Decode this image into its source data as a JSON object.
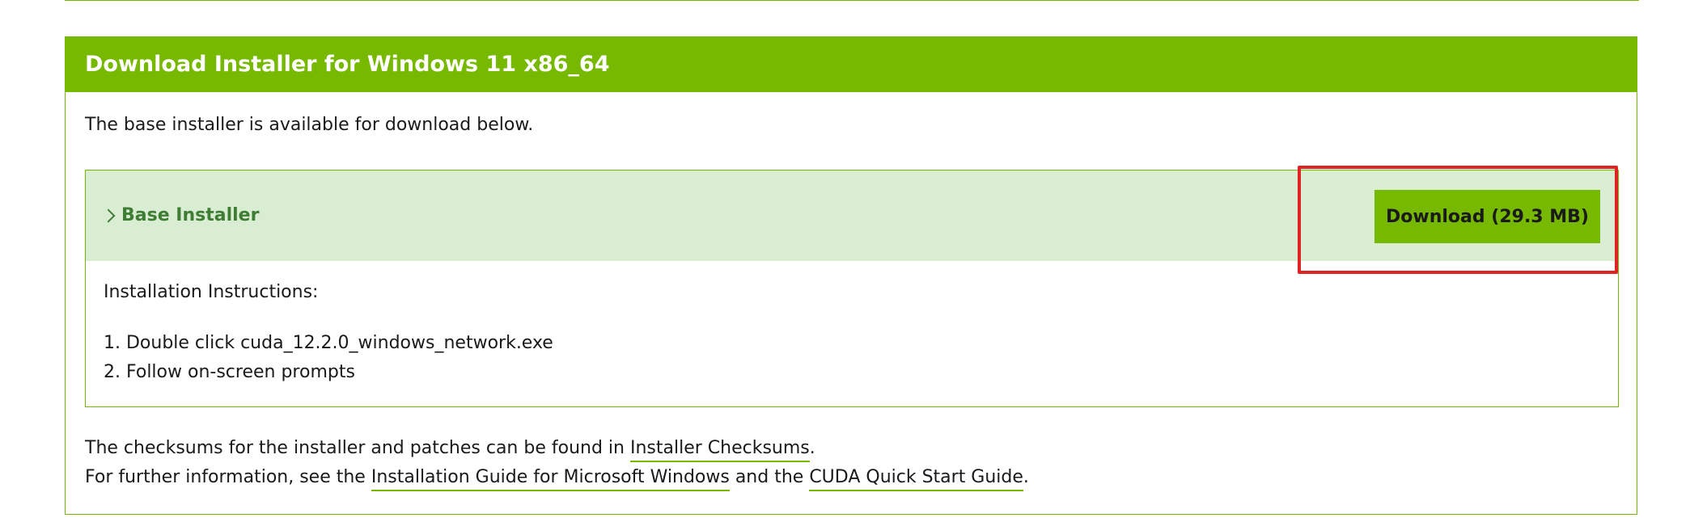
{
  "panel": {
    "header": "Download Installer for Windows 11 x86_64",
    "intro": "The base installer is available for download below."
  },
  "installer": {
    "title": "Base Installer",
    "download_label": "Download (29.3 MB)",
    "instructions_label": "Installation Instructions:",
    "steps": [
      "1. Double click cuda_12.2.0_windows_network.exe",
      "2. Follow on-screen prompts"
    ]
  },
  "footer": {
    "line1_prefix": "The checksums for the installer and patches can be found in ",
    "line1_link": "Installer Checksums",
    "line1_suffix": ".",
    "line2_prefix": "For further information, see the ",
    "line2_link1": "Installation Guide for Microsoft Windows",
    "line2_middle": " and the ",
    "line2_link2": "CUDA Quick Start Guide",
    "line2_suffix": "."
  },
  "colors": {
    "accent": "#76b900",
    "installer_head_bg": "#d9edd2",
    "installer_title": "#3f7d34",
    "highlight": "#e02424"
  },
  "icons": {
    "expand": "chevron-right-icon"
  }
}
